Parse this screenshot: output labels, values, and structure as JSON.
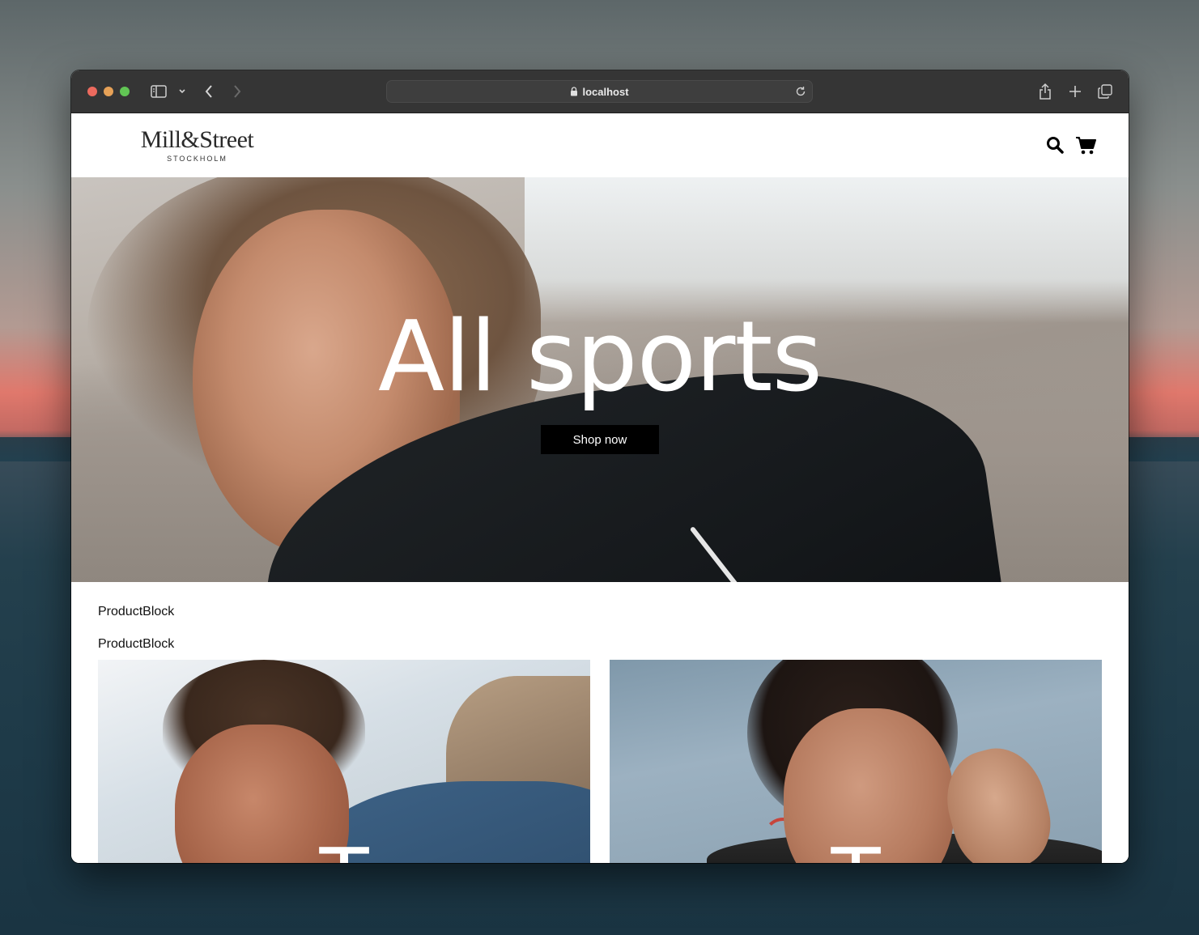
{
  "browser": {
    "url": "localhost",
    "icons": [
      "sidebar-icon",
      "chevron-down-icon",
      "back-icon",
      "forward-icon",
      "lock-icon",
      "reload-icon",
      "share-icon",
      "plus-icon",
      "tabs-icon"
    ]
  },
  "site": {
    "logo_main": "Mill&Street",
    "logo_sub": "STOCKHOLM",
    "header_icons": [
      "search-icon",
      "cart-icon"
    ]
  },
  "hero": {
    "title": "All sports",
    "button_label": "Shop now"
  },
  "blocks": [
    "ProductBlock",
    "ProductBlock"
  ],
  "cards": [
    {
      "title": "T"
    },
    {
      "title": "T"
    }
  ]
}
